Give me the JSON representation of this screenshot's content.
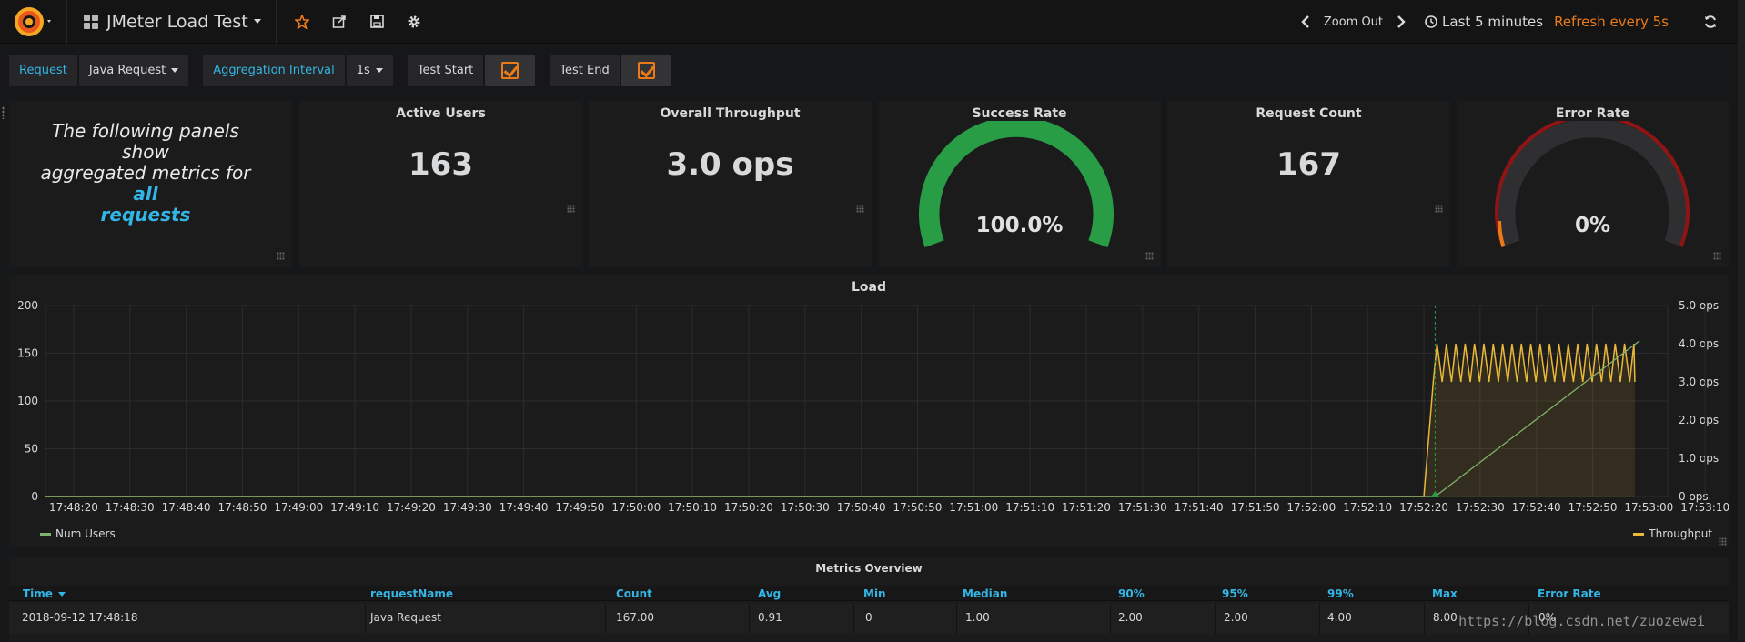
{
  "navbar": {
    "dashboard_title": "JMeter Load Test",
    "zoom_out": "Zoom Out",
    "time_range": "Last 5 minutes",
    "refresh": "Refresh every 5s"
  },
  "variables": {
    "request_label": "Request",
    "request_value": "Java Request",
    "agg_label": "Aggregation Interval",
    "agg_value": "1s",
    "test_start": "Test Start",
    "test_end": "Test End"
  },
  "text_panel": {
    "line1": "The following panels show",
    "line2a": "aggregated metrics for ",
    "highlight1": "all",
    "highlight2": "requests"
  },
  "stats": {
    "active_users": {
      "title": "Active Users",
      "value": "163"
    },
    "throughput": {
      "title": "Overall Throughput",
      "value": "3.0 ops"
    },
    "success_rate": {
      "title": "Success Rate",
      "value": "100.0%",
      "level": 1.0
    },
    "request_count": {
      "title": "Request Count",
      "value": "167"
    },
    "error_rate": {
      "title": "Error Rate",
      "value": "0%",
      "level": 0.0
    }
  },
  "colors": {
    "accent": "#33b5e5",
    "orange": "#eb7b18",
    "green": "#299c46",
    "num_users": "#7eb26d",
    "throughput": "#eab839",
    "gauge_red": "#8f1515"
  },
  "chart_data": {
    "type": "line",
    "title": "Load",
    "x": [
      "17:48:20",
      "17:48:30",
      "17:48:40",
      "17:48:50",
      "17:49:00",
      "17:49:10",
      "17:49:20",
      "17:49:30",
      "17:49:40",
      "17:49:50",
      "17:50:00",
      "17:50:10",
      "17:50:20",
      "17:50:30",
      "17:50:40",
      "17:50:50",
      "17:51:00",
      "17:51:10",
      "17:51:20",
      "17:51:30",
      "17:51:40",
      "17:51:50",
      "17:52:00",
      "17:52:10",
      "17:52:20",
      "17:52:30",
      "17:52:40",
      "17:52:50",
      "17:53:00",
      "17:53:10"
    ],
    "y_left": {
      "ticks": [
        "0",
        "50",
        "100",
        "150",
        "200"
      ],
      "range": [
        0,
        200
      ]
    },
    "y_right": {
      "ticks": [
        "0 ops",
        "1.0 ops",
        "2.0 ops",
        "3.0 ops",
        "4.0 ops",
        "5.0 ops"
      ],
      "range": [
        0,
        5
      ]
    },
    "grid": true,
    "legend_left": "Num Users",
    "legend_right": "Throughput",
    "series": [
      {
        "name": "Num Users",
        "axis": "left",
        "points": [
          [
            147.0,
            0
          ],
          [
            148.2,
            0
          ],
          [
            170.0,
            163
          ]
        ]
      },
      {
        "name": "Throughput",
        "axis": "right",
        "points": [
          [
            147.0,
            0
          ],
          [
            148.0,
            3.0
          ],
          [
            148.4,
            4.0
          ],
          [
            149.0,
            3.0
          ],
          [
            169.5,
            3.0
          ]
        ]
      }
    ]
  },
  "table": {
    "title": "Metrics Overview",
    "columns": [
      "Time",
      "requestName",
      "Count",
      "Avg",
      "Min",
      "Median",
      "90%",
      "95%",
      "99%",
      "Max",
      "Error Rate"
    ],
    "rows": [
      [
        "2018-09-12 17:48:18",
        "Java Request",
        "167.00",
        "0.91",
        "0",
        "1.00",
        "2.00",
        "2.00",
        "4.00",
        "8.00",
        "0%"
      ]
    ]
  },
  "watermark": "https://blog.csdn.net/zuozewei"
}
